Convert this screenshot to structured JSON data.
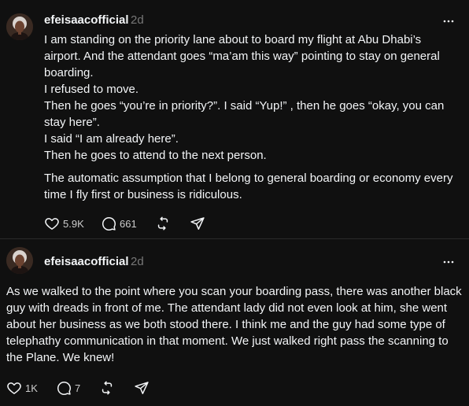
{
  "posts": [
    {
      "username": "efeisaacofficial",
      "time": "2d",
      "paragraph1": [
        "I am standing on the priority lane about to board my flight at Abu Dhabi’s airport. And the attendant goes “ma’am this way” pointing to stay on general boarding.",
        "I refused to move.",
        "Then he goes “you’re in priority?”. I said “Yup!” , then he goes “okay, you can stay here”.",
        "I said “I am already here”.",
        "Then he goes to attend to the next person."
      ],
      "paragraph2": "The automatic assumption that I belong to general boarding or economy every time I fly first or business is ridiculous.",
      "likes": "5.9K",
      "replies": "661",
      "icons": {
        "like": "heart-icon",
        "reply": "comment-icon",
        "repost": "repost-icon",
        "share": "send-icon",
        "more": "more-icon"
      }
    },
    {
      "username": "efeisaacofficial",
      "time": "2d",
      "paragraph1": "As we walked to the point where you scan your boarding pass, there was another black guy with dreads in front of me. The attendant lady did not even look at him, she went about her business as we both stood there. I think me and the guy had some type of telephathy communication in that moment. We just walked right pass the scanning to the Plane. We knew!",
      "likes": "1K",
      "replies": "7"
    }
  ],
  "colors": {
    "background": "#101010",
    "text": "#f3f5f7",
    "muted": "#777777",
    "divider": "#2a2a2a"
  }
}
